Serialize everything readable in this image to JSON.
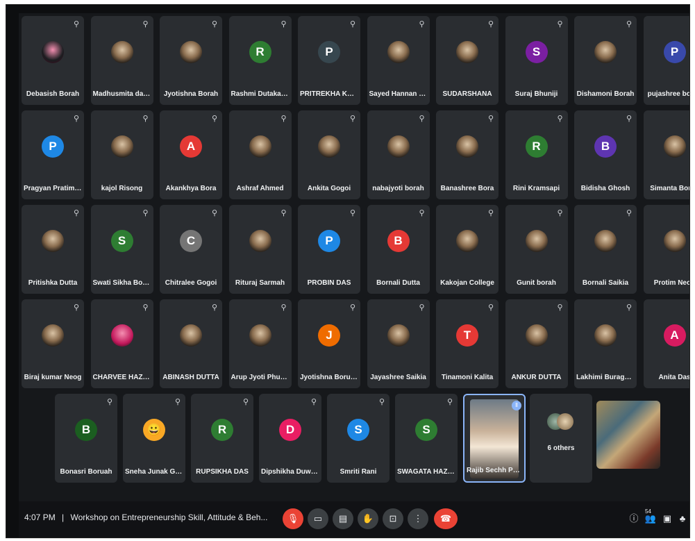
{
  "grid_rows": [
    [
      {
        "name": "Debasish Borah",
        "letter": "",
        "color": "#1b1d20",
        "photo": true
      },
      {
        "name": "Madhusmita das ...",
        "letter": "",
        "color": "",
        "photo": true
      },
      {
        "name": "Jyotishna Borah",
        "letter": "",
        "color": "",
        "photo": true
      },
      {
        "name": "Rashmi Dutakakho...",
        "letter": "R",
        "color": "#2e7d32",
        "photo": false
      },
      {
        "name": "PRITREKHA KALITA",
        "letter": "P",
        "color": "#37474f",
        "photo": false
      },
      {
        "name": "Sayed Hannan Ullah",
        "letter": "",
        "color": "",
        "photo": true
      },
      {
        "name": "SUDARSHANA",
        "letter": "",
        "color": "",
        "photo": true
      },
      {
        "name": "Suraj Bhuniji",
        "letter": "S",
        "color": "#7b1fa2",
        "photo": false
      },
      {
        "name": "Dishamoni Borah",
        "letter": "",
        "color": "",
        "photo": true
      },
      {
        "name": "pujashree borah",
        "letter": "P",
        "color": "#3949ab",
        "photo": false
      }
    ],
    [
      {
        "name": "Pragyan Pratim C...",
        "letter": "P",
        "color": "#1e88e5",
        "photo": false
      },
      {
        "name": "kajol Risong",
        "letter": "",
        "color": "",
        "photo": true
      },
      {
        "name": "Akankhya Bora",
        "letter": "A",
        "color": "#e53935",
        "photo": false
      },
      {
        "name": "Ashraf Ahmed",
        "letter": "",
        "color": "",
        "photo": true
      },
      {
        "name": "Ankita Gogoi",
        "letter": "",
        "color": "",
        "photo": true
      },
      {
        "name": "nabajyoti borah",
        "letter": "",
        "color": "",
        "photo": true
      },
      {
        "name": "Banashree Bora",
        "letter": "",
        "color": "",
        "photo": true
      },
      {
        "name": "Rini Kramsapi",
        "letter": "R",
        "color": "#2e7d32",
        "photo": false
      },
      {
        "name": "Bidisha Ghosh",
        "letter": "B",
        "color": "#5e35b1",
        "photo": false
      },
      {
        "name": "Simanta Borah",
        "letter": "",
        "color": "",
        "photo": true
      }
    ],
    [
      {
        "name": "Pritishka Dutta",
        "letter": "",
        "color": "",
        "photo": true
      },
      {
        "name": "Swati Sikha Borah",
        "letter": "S",
        "color": "#2e7d32",
        "photo": false
      },
      {
        "name": "Chitralee Gogoi",
        "letter": "C",
        "color": "#757575",
        "photo": false
      },
      {
        "name": "Rituraj Sarmah",
        "letter": "",
        "color": "",
        "photo": true
      },
      {
        "name": "PROBIN DAS",
        "letter": "P",
        "color": "#1e88e5",
        "photo": false
      },
      {
        "name": "Bornali Dutta",
        "letter": "B",
        "color": "#e53935",
        "photo": false
      },
      {
        "name": "Kakojan College",
        "letter": "",
        "color": "",
        "photo": true
      },
      {
        "name": "Gunit borah",
        "letter": "",
        "color": "",
        "photo": true
      },
      {
        "name": "Bornali Saikia",
        "letter": "",
        "color": "",
        "photo": true
      },
      {
        "name": "Protim Neog",
        "letter": "",
        "color": "",
        "photo": true
      }
    ],
    [
      {
        "name": "Biraj kumar Neog",
        "letter": "",
        "color": "",
        "photo": true
      },
      {
        "name": "CHARVEE HAZARI...",
        "letter": "",
        "color": "#c2185b",
        "photo": true
      },
      {
        "name": "ABINASH DUTTA",
        "letter": "",
        "color": "",
        "photo": true
      },
      {
        "name": "Arup Jyoti Phukan",
        "letter": "",
        "color": "",
        "photo": true
      },
      {
        "name": "Jyotishna Boruah",
        "letter": "J",
        "color": "#ef6c00",
        "photo": false
      },
      {
        "name": "Jayashree Saikia",
        "letter": "",
        "color": "",
        "photo": true
      },
      {
        "name": "Tinamoni Kalita",
        "letter": "T",
        "color": "#e53935",
        "photo": false
      },
      {
        "name": "ANKUR DUTTA",
        "letter": "",
        "color": "",
        "photo": true
      },
      {
        "name": "Lakhimi Buragohain",
        "letter": "",
        "color": "",
        "photo": true
      },
      {
        "name": "Anita Das",
        "letter": "A",
        "color": "#d81b60",
        "photo": false
      }
    ]
  ],
  "last_row": [
    {
      "name": "Bonasri Boruah",
      "letter": "B",
      "color": "#1b5e20",
      "photo": false
    },
    {
      "name": "Sneha Junak Gogoi",
      "letter": "😀",
      "color": "#f9a825",
      "photo": false
    },
    {
      "name": "RUPSIKHA DAS",
      "letter": "R",
      "color": "#2e7d32",
      "photo": false
    },
    {
      "name": "Dipshikha Duwarah",
      "letter": "D",
      "color": "#e91e63",
      "photo": false
    },
    {
      "name": "Smriti Rani",
      "letter": "S",
      "color": "#1e88e5",
      "photo": false
    },
    {
      "name": "SWAGATA HAZAR...",
      "letter": "S",
      "color": "#2e7d32",
      "photo": false
    }
  ],
  "speaker": {
    "name": "Rajib Sechh Pandit"
  },
  "others": {
    "label": "6 others"
  },
  "meeting": {
    "time": "4:07 PM",
    "separator": "|",
    "title": "Workshop on Entrepreneurship Skill, Attitude & Beh..."
  },
  "participants_count": "54",
  "colors": {
    "end_call": "#ea4335",
    "mic_off": "#ea4335",
    "accent": "#8ab4f8"
  }
}
